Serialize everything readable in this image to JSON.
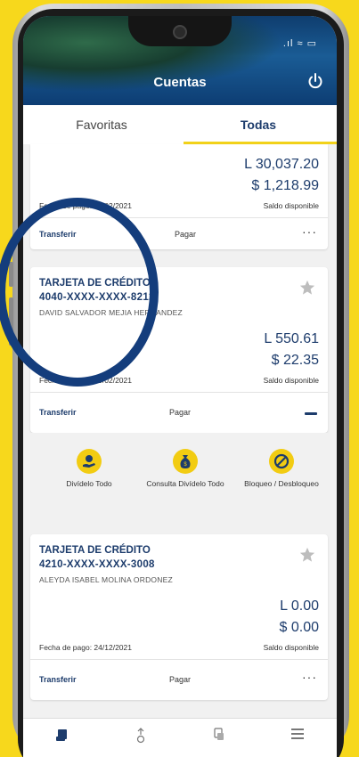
{
  "header": {
    "title": "Cuentas",
    "status_icons": ".ıl ≈ ▭"
  },
  "tabs": [
    {
      "label": "Favoritas",
      "active": false
    },
    {
      "label": "Todas",
      "active": true
    }
  ],
  "cards": [
    {
      "amount_l": "L 30,037.20",
      "amount_d": "$ 1,218.99",
      "due": "Fecha de pago: 20/02/2021",
      "available_label": "Saldo disponible",
      "transfer": "Transferir",
      "pay": "Pagar"
    },
    {
      "title": "TARJETA DE CRÉDITO",
      "number": "4040-XXXX-XXXX-8212",
      "holder": "DAVID SALVADOR MEJIA HERNANDEZ",
      "amount_l": "L 550.61",
      "amount_d": "$ 22.35",
      "due": "Fecha de pago: 20/02/2021",
      "available_label": "Saldo disponible",
      "transfer": "Transferir",
      "pay": "Pagar"
    },
    {
      "title": "TARJETA DE CRÉDITO",
      "number": "4210-XXXX-XXXX-3008",
      "holder": "ALEYDA ISABEL MOLINA ORDONEZ",
      "amount_l": "L 0.00",
      "amount_d": "$ 0.00",
      "due": "Fecha de pago: 24/12/2021",
      "available_label": "Saldo disponible",
      "transfer": "Transferir",
      "pay": "Pagar"
    }
  ],
  "quick_actions": [
    {
      "label": "Divídelo Todo",
      "icon": "hand-coin-icon"
    },
    {
      "label": "Consulta Divídelo Todo",
      "icon": "money-bag-icon"
    },
    {
      "label": "Bloqueo / Desbloqueo",
      "icon": "block-icon"
    }
  ],
  "bottom_nav": [
    {
      "icon": "accounts-icon"
    },
    {
      "icon": "transfer-icon"
    },
    {
      "icon": "payments-icon"
    },
    {
      "icon": "menu-icon"
    }
  ],
  "colors": {
    "brand_blue": "#1d3c6c",
    "accent_yellow": "#f2d21a",
    "background": "#f7d81c"
  }
}
